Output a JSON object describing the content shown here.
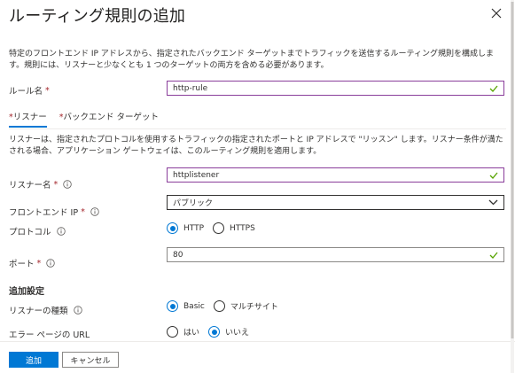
{
  "header": {
    "title": "ルーティング規則の追加",
    "close_icon": "close-icon"
  },
  "description": "特定のフロントエンド IP アドレスから、指定されたバックエンド ターゲットまでトラフィックを送信するルーティング規則を構成します。規則には、リスナーと少なくとも 1 つのターゲットの両方を含める必要があります。",
  "rule_name": {
    "label": "ルール名",
    "required": "*",
    "value": "http-rule"
  },
  "tabs": [
    {
      "star": "*",
      "label": "リスナー"
    },
    {
      "star": "*",
      "label": "バックエンド ターゲット"
    }
  ],
  "listener_description": "リスナーは、指定されたプロトコルを使用するトラフィックの指定されたポートと IP アドレスで \"リッスン\" します。リスナー条件が満たされる場合、アプリケーション ゲートウェイは、このルーティング規則を適用します。",
  "listener_name": {
    "label": "リスナー名",
    "required": "*",
    "value": "httplistener"
  },
  "frontend_ip": {
    "label": "フロントエンド IP",
    "required": "*",
    "value": "パブリック"
  },
  "protocol": {
    "label": "プロトコル",
    "options": [
      "HTTP",
      "HTTPS"
    ],
    "selected": "HTTP"
  },
  "port": {
    "label": "ポート",
    "required": "*",
    "value": "80"
  },
  "additional_settings": {
    "title": "追加設定"
  },
  "listener_type": {
    "label": "リスナーの種類",
    "options": [
      "Basic",
      "マルチサイト"
    ],
    "selected": "Basic"
  },
  "error_page_url": {
    "label": "エラー ページの URL",
    "options": [
      "はい",
      "いいえ"
    ],
    "selected": "いいえ"
  },
  "footer": {
    "add_label": "追加",
    "cancel_label": "キャンセル"
  },
  "colors": {
    "accent": "#0078d4",
    "valid_check": "#57a300",
    "required": "#a4262c",
    "valid_border": "#8a3d9a"
  }
}
